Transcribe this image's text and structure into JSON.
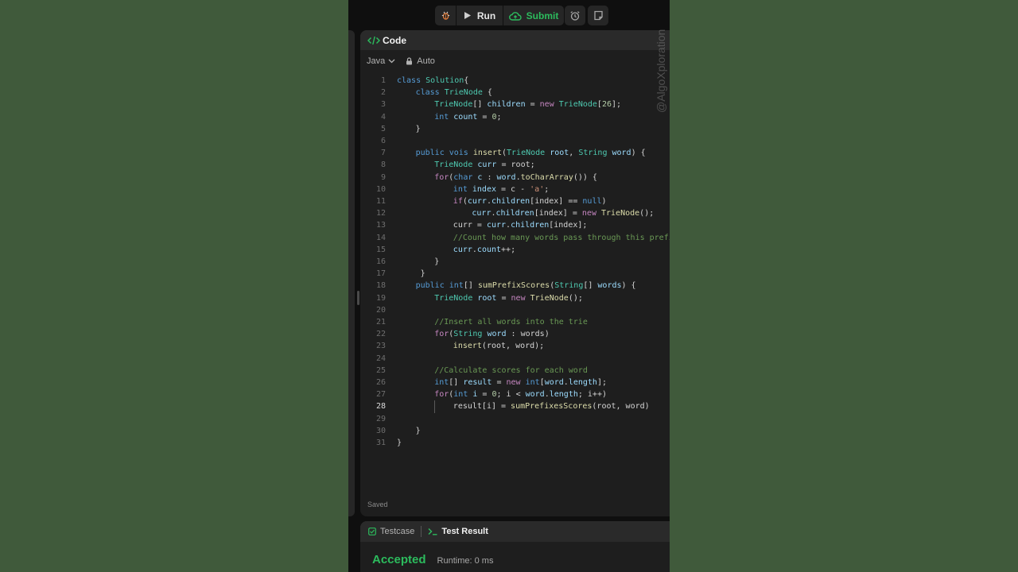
{
  "toolbar": {
    "run_label": "Run",
    "submit_label": "Submit"
  },
  "code_panel": {
    "title": "Code",
    "language": "Java",
    "mode": "Auto",
    "saved_text": "Saved"
  },
  "editor": {
    "active_line": 28,
    "lines": [
      {
        "n": "1",
        "indent": 0,
        "tokens": [
          [
            "kw2",
            "class "
          ],
          [
            "ty",
            "Solution"
          ],
          [
            "",
            "{"
          ]
        ]
      },
      {
        "n": "2",
        "indent": 1,
        "tokens": [
          [
            "kw2",
            "class "
          ],
          [
            "ty",
            "TrieNode "
          ],
          [
            "",
            "{"
          ]
        ]
      },
      {
        "n": "3",
        "indent": 2,
        "tokens": [
          [
            "ty",
            "TrieNode"
          ],
          [
            "",
            "[] "
          ],
          [
            "vr",
            "children"
          ],
          [
            "",
            " = "
          ],
          [
            "kw",
            "new "
          ],
          [
            "ty",
            "TrieNode"
          ],
          [
            "",
            "["
          ],
          [
            "nm",
            "26"
          ],
          [
            "",
            "];"
          ]
        ]
      },
      {
        "n": "4",
        "indent": 2,
        "tokens": [
          [
            "kw2",
            "int "
          ],
          [
            "vr",
            "count"
          ],
          [
            "",
            " = "
          ],
          [
            "nm",
            "0"
          ],
          [
            "",
            ";"
          ]
        ]
      },
      {
        "n": "5",
        "indent": 1,
        "tokens": [
          [
            "",
            "}"
          ]
        ]
      },
      {
        "n": "6",
        "indent": 0,
        "tokens": []
      },
      {
        "n": "7",
        "indent": 1,
        "tokens": [
          [
            "kw2",
            "public "
          ],
          [
            "kw2",
            "vois "
          ],
          [
            "fn",
            "insert"
          ],
          [
            "",
            "("
          ],
          [
            "ty",
            "TrieNode "
          ],
          [
            "vr",
            "root"
          ],
          [
            "",
            ", "
          ],
          [
            "ty",
            "String "
          ],
          [
            "vr",
            "word"
          ],
          [
            "",
            ") {"
          ]
        ]
      },
      {
        "n": "8",
        "indent": 2,
        "tokens": [
          [
            "ty",
            "TrieNode "
          ],
          [
            "vr",
            "curr"
          ],
          [
            "",
            " = root;"
          ]
        ]
      },
      {
        "n": "9",
        "indent": 2,
        "tokens": [
          [
            "kw",
            "for"
          ],
          [
            "",
            "("
          ],
          [
            "kw2",
            "char "
          ],
          [
            "vr",
            "c"
          ],
          [
            "",
            " : "
          ],
          [
            "vr",
            "word"
          ],
          [
            "",
            "."
          ],
          [
            "fn",
            "toCharArray"
          ],
          [
            "",
            "()) {"
          ]
        ]
      },
      {
        "n": "10",
        "indent": 3,
        "tokens": [
          [
            "kw2",
            "int "
          ],
          [
            "vr",
            "index"
          ],
          [
            "",
            " = c - "
          ],
          [
            "st",
            "'a'"
          ],
          [
            "",
            ";"
          ]
        ]
      },
      {
        "n": "11",
        "indent": 3,
        "tokens": [
          [
            "kw",
            "if"
          ],
          [
            "",
            "("
          ],
          [
            "vr",
            "curr"
          ],
          [
            "",
            "."
          ],
          [
            "vr",
            "children"
          ],
          [
            "",
            "[index] == "
          ],
          [
            "kw2",
            "null"
          ],
          [
            "",
            ")"
          ]
        ]
      },
      {
        "n": "12",
        "indent": 4,
        "tokens": [
          [
            "vr",
            "curr"
          ],
          [
            "",
            "."
          ],
          [
            "vr",
            "children"
          ],
          [
            "",
            "[index] = "
          ],
          [
            "kw",
            "new "
          ],
          [
            "fn",
            "TrieNode"
          ],
          [
            "",
            "();"
          ]
        ]
      },
      {
        "n": "13",
        "indent": 3,
        "tokens": [
          [
            "",
            "curr = "
          ],
          [
            "vr",
            "curr"
          ],
          [
            "",
            "."
          ],
          [
            "vr",
            "children"
          ],
          [
            "",
            "[index];"
          ]
        ]
      },
      {
        "n": "14",
        "indent": 3,
        "tokens": [
          [
            "cm",
            "//Count how many words pass through this prefix"
          ]
        ]
      },
      {
        "n": "15",
        "indent": 3,
        "tokens": [
          [
            "vr",
            "curr"
          ],
          [
            "",
            "."
          ],
          [
            "vr",
            "count"
          ],
          [
            "",
            "++;"
          ]
        ]
      },
      {
        "n": "16",
        "indent": 2,
        "tokens": [
          [
            "",
            "}"
          ]
        ]
      },
      {
        "n": "17",
        "indent": 1,
        "tokens": [
          [
            "",
            " }"
          ]
        ]
      },
      {
        "n": "18",
        "indent": 1,
        "tokens": [
          [
            "kw2",
            "public "
          ],
          [
            "kw2",
            "int"
          ],
          [
            "",
            "[] "
          ],
          [
            "fn",
            "sumPrefixScores"
          ],
          [
            "",
            "("
          ],
          [
            "ty",
            "String"
          ],
          [
            "",
            "[] "
          ],
          [
            "vr",
            "words"
          ],
          [
            "",
            ") {"
          ]
        ]
      },
      {
        "n": "19",
        "indent": 2,
        "tokens": [
          [
            "ty",
            "TrieNode "
          ],
          [
            "vr",
            "root"
          ],
          [
            "",
            " = "
          ],
          [
            "kw",
            "new "
          ],
          [
            "fn",
            "TrieNode"
          ],
          [
            "",
            "();"
          ]
        ]
      },
      {
        "n": "20",
        "indent": 0,
        "tokens": []
      },
      {
        "n": "21",
        "indent": 2,
        "tokens": [
          [
            "cm",
            "//Insert all words into the trie"
          ]
        ]
      },
      {
        "n": "22",
        "indent": 2,
        "tokens": [
          [
            "kw",
            "for"
          ],
          [
            "",
            "("
          ],
          [
            "ty",
            "String "
          ],
          [
            "vr",
            "word"
          ],
          [
            "",
            " : words)"
          ]
        ]
      },
      {
        "n": "23",
        "indent": 3,
        "tokens": [
          [
            "fn",
            "insert"
          ],
          [
            "",
            "(root, word);"
          ]
        ]
      },
      {
        "n": "24",
        "indent": 0,
        "tokens": []
      },
      {
        "n": "25",
        "indent": 2,
        "tokens": [
          [
            "cm",
            "//Calculate scores for each word"
          ]
        ]
      },
      {
        "n": "26",
        "indent": 2,
        "tokens": [
          [
            "kw2",
            "int"
          ],
          [
            "",
            "[] "
          ],
          [
            "vr",
            "result"
          ],
          [
            "",
            " = "
          ],
          [
            "kw",
            "new "
          ],
          [
            "kw2",
            "int"
          ],
          [
            "",
            "["
          ],
          [
            "vr",
            "word"
          ],
          [
            "",
            "."
          ],
          [
            "vr",
            "length"
          ],
          [
            "",
            "];"
          ]
        ]
      },
      {
        "n": "27",
        "indent": 2,
        "tokens": [
          [
            "kw",
            "for"
          ],
          [
            "",
            "("
          ],
          [
            "kw2",
            "int "
          ],
          [
            "vr",
            "i"
          ],
          [
            "",
            " = "
          ],
          [
            "nm",
            "0"
          ],
          [
            "",
            "; i < "
          ],
          [
            "vr",
            "word"
          ],
          [
            "",
            "."
          ],
          [
            "vr",
            "length"
          ],
          [
            "",
            "; i++)"
          ]
        ]
      },
      {
        "n": "28",
        "indent": 3,
        "tokens": [
          [
            "",
            "result[i] = "
          ],
          [
            "fn",
            "sumPrefixesScores"
          ],
          [
            "",
            "(root, word)"
          ]
        ]
      },
      {
        "n": "29",
        "indent": 0,
        "tokens": []
      },
      {
        "n": "30",
        "indent": 1,
        "tokens": [
          [
            "",
            "}"
          ]
        ]
      },
      {
        "n": "31",
        "indent": 0,
        "tokens": [
          [
            "",
            "}"
          ]
        ]
      }
    ]
  },
  "bottom": {
    "tab_testcase": "Testcase",
    "tab_test_result": "Test Result",
    "status": "Accepted",
    "runtime": "Runtime: 0 ms"
  },
  "watermark": "@AlgoXploration",
  "colors": {
    "background": "#405a3b",
    "panel": "#1e1e1e",
    "accent_green": "#2cbb5d"
  }
}
